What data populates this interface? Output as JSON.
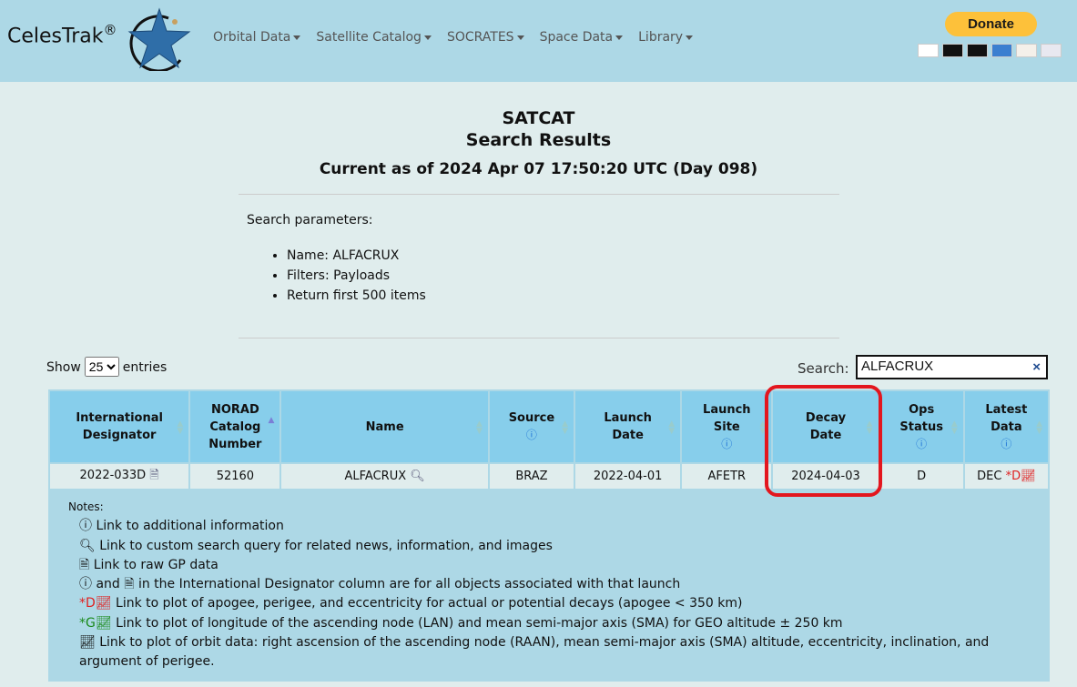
{
  "header": {
    "brand": "CelesTrak",
    "reg": "®",
    "nav": [
      "Orbital Data",
      "Satellite Catalog",
      "SOCRATES",
      "Space Data",
      "Library"
    ],
    "donate": "Donate"
  },
  "page": {
    "title1": "SATCAT",
    "title2": "Search Results",
    "current": "Current as of 2024 Apr 07 17:50:20 UTC (Day 098)"
  },
  "params": {
    "label": "Search parameters:",
    "items": [
      "Name: ALFACRUX",
      "Filters: Payloads",
      "Return first 500 items"
    ]
  },
  "controls": {
    "show": "Show",
    "entries": "entries",
    "page_size": "25",
    "search_label": "Search:",
    "search_value": "ALFACRUX",
    "clear": "×"
  },
  "table": {
    "headers": [
      "International Designator",
      "NORAD Catalog Number",
      "Name",
      "Source",
      "Launch Date",
      "Launch Site",
      "Decay Date",
      "Ops Status",
      "Latest Data"
    ],
    "row": {
      "intl": "2022-033D",
      "norad": "52160",
      "name": "ALFACRUX",
      "source": "BRAZ",
      "launch": "2022-04-01",
      "site": "AFETR",
      "decay": "2024-04-03",
      "ops": "D",
      "latest": "DEC",
      "flag": "*D"
    }
  },
  "notes": {
    "title": "Notes:",
    "items": [
      "Link to additional information",
      "Link to custom search query for related news, information, and images",
      "Link to raw GP data",
      "in the International Designator column are for all objects associated with that launch",
      "Link to plot of apogee, perigee, and eccentricity for actual or potential decays (apogee < 350 km)",
      "Link to plot of longitude of the ascending node (LAN) and mean semi-major axis (SMA) for GEO altitude ± 250 km",
      "Link to plot of orbit data: right ascension of the ascending node (RAAN), mean semi-major axis (SMA) altitude, eccentricity, inclination, and argument of perigee."
    ],
    "and": "and",
    "d": "*D",
    "g": "*G"
  }
}
